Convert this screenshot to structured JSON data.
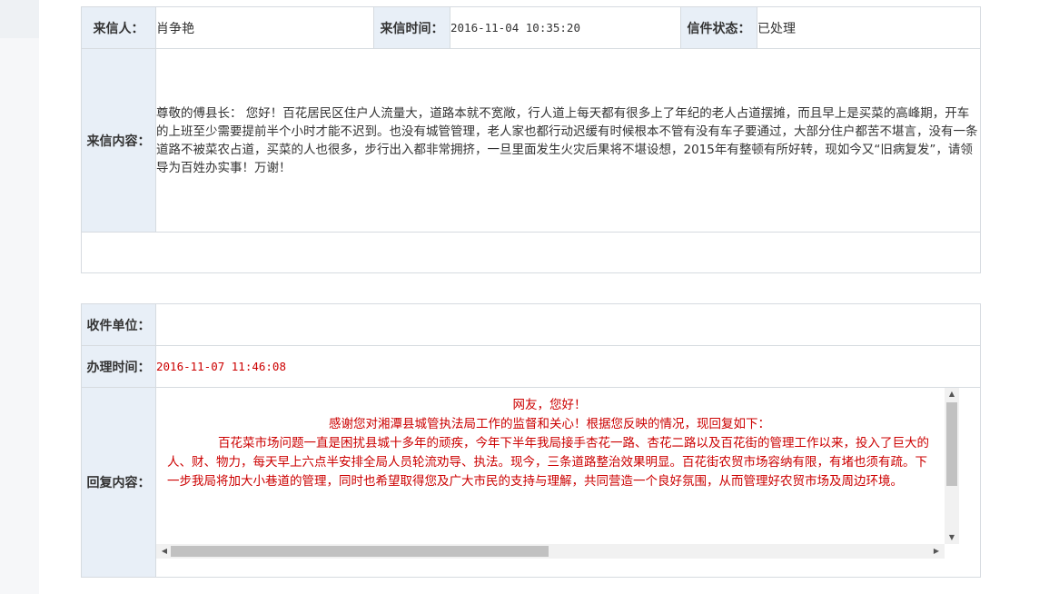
{
  "letter": {
    "sender_label": "来信人：",
    "sender_value": "肖争艳",
    "time_label": "来信时间：",
    "time_value": "2016-11-04 10:35:20",
    "status_label": "信件状态：",
    "status_value": "已处理",
    "content_label": "来信内容：",
    "content_text": "  尊敬的傅县长：  您好！百花居民区住户人流量大，道路本就不宽敞，行人道上每天都有很多上了年纪的老人占道摆摊，而且早上是买菜的高峰期，开车的上班至少需要提前半个小时才能不迟到。也没有城管管理，老人家也都行动迟缓有时候根本不管有没有车子要通过，大部分住户都苦不堪言，没有一条道路不被菜农占道，买菜的人也很多，步行出入都非常拥挤，一旦里面发生火灾后果将不堪设想，2015年有整顿有所好转，现如今又“旧病复发”，请领导为百姓办实事！万谢！"
  },
  "reply": {
    "unit_label": "收件单位：",
    "unit_value": "",
    "time_label": "办理时间：",
    "time_value": "2016-11-07 11:46:08",
    "content_label": "回复内容：",
    "greeting": "网友，您好！",
    "line2": "感谢您对湘潭县城管执法局工作的监督和关心！根据您反映的情况，现回复如下：",
    "body": "百花菜市场问题一直是困扰县城十多年的顽疾，今年下半年我局接手杏花一路、杏花二路以及百花街的管理工作以来，投入了巨大的人、财、物力，每天早上六点半安排全局人员轮流劝导、执法。现今，三条道路整治效果明显。百花街农贸市场容纳有限，有堵也须有疏。下一步我局将加大小巷道的管理，同时也希望取得您及广大市民的支持与理解，共同营造一个良好氛围，从而管理好农贸市场及周边环境。"
  },
  "icons": {
    "scroll_up": "scroll-up-arrow",
    "scroll_down": "scroll-down-arrow",
    "scroll_left": "scroll-left-arrow",
    "scroll_right": "scroll-right-arrow"
  },
  "colors": {
    "label_bg": "#e8eff7",
    "border": "#d6dbe0",
    "reply_text": "#cc0000"
  }
}
